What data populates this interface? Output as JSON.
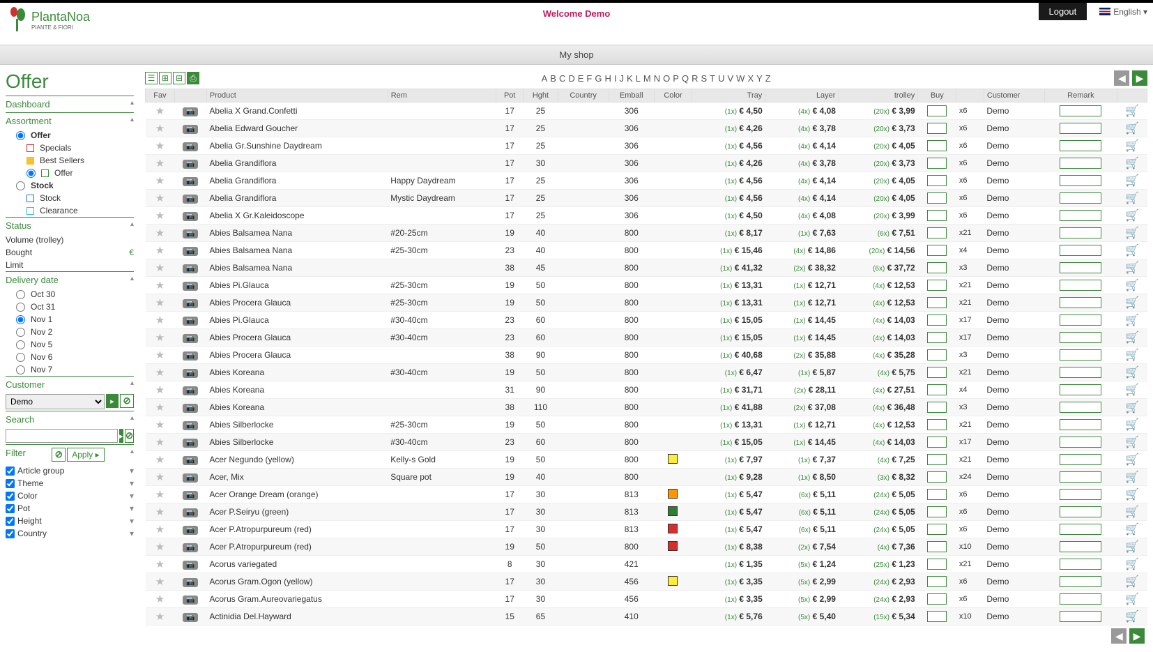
{
  "header": {
    "welcome": "Welcome Demo",
    "logout": "Logout",
    "language": "English ▾",
    "logo_main": "PlantaNoa",
    "logo_sub": "PIANTE & FIORI",
    "shop_banner": "My shop"
  },
  "page_title": "Offer",
  "sidebar": {
    "dashboard": "Dashboard",
    "assortment": "Assortment",
    "offer_group": "Offer",
    "specials": "Specials",
    "bestsellers": "Best Sellers",
    "offer_item": "Offer",
    "stock_group": "Stock",
    "stock_item": "Stock",
    "clearance": "Clearance",
    "status": "Status",
    "volume": "Volume (trolley)",
    "bought": "Bought",
    "bought_val": "€",
    "limit": "Limit",
    "delivery": "Delivery date",
    "dates": [
      "Oct 30",
      "Oct 31",
      "Nov 1",
      "Nov 2",
      "Nov 5",
      "Nov 6",
      "Nov 7"
    ],
    "date_selected": 2,
    "customer": "Customer",
    "customer_val": "Demo",
    "search": "Search",
    "filter": "Filter",
    "apply": "Apply",
    "filters": [
      "Article group",
      "Theme",
      "Color",
      "Pot",
      "Height",
      "Country"
    ]
  },
  "alpha": [
    "A",
    "B",
    "C",
    "D",
    "E",
    "F",
    "G",
    "H",
    "I",
    "J",
    "K",
    "L",
    "M",
    "N",
    "O",
    "P",
    "Q",
    "R",
    "S",
    "T",
    "U",
    "V",
    "W",
    "X",
    "Y",
    "Z"
  ],
  "columns": [
    "Fav",
    "",
    "Product",
    "Rem",
    "Pot",
    "Hght",
    "Country",
    "Emball",
    "Color",
    "Tray",
    "Layer",
    "trolley",
    "Buy",
    "",
    "Customer",
    "Remark",
    ""
  ],
  "rows": [
    {
      "product": "Abelia X Grand.Confetti",
      "rem": "",
      "pot": "17",
      "hght": "25",
      "emb": "306",
      "color": "",
      "tm": "(1x)",
      "tp": "€ 4,50",
      "lm": "(4x)",
      "lp": "€ 4,08",
      "rm2": "(20x)",
      "rp": "€ 3,99",
      "pack": "x6",
      "cust": "Demo"
    },
    {
      "product": "Abelia Edward Goucher",
      "rem": "",
      "pot": "17",
      "hght": "25",
      "emb": "306",
      "color": "",
      "tm": "(1x)",
      "tp": "€ 4,26",
      "lm": "(4x)",
      "lp": "€ 3,78",
      "rm2": "(20x)",
      "rp": "€ 3,73",
      "pack": "x6",
      "cust": "Demo"
    },
    {
      "product": "Abelia Gr.Sunshine Daydream",
      "rem": "",
      "pot": "17",
      "hght": "25",
      "emb": "306",
      "color": "",
      "tm": "(1x)",
      "tp": "€ 4,56",
      "lm": "(4x)",
      "lp": "€ 4,14",
      "rm2": "(20x)",
      "rp": "€ 4,05",
      "pack": "x6",
      "cust": "Demo"
    },
    {
      "product": "Abelia Grandiflora",
      "rem": "",
      "pot": "17",
      "hght": "30",
      "emb": "306",
      "color": "",
      "tm": "(1x)",
      "tp": "€ 4,26",
      "lm": "(4x)",
      "lp": "€ 3,78",
      "rm2": "(20x)",
      "rp": "€ 3,73",
      "pack": "x6",
      "cust": "Demo"
    },
    {
      "product": "Abelia Grandiflora",
      "rem": "Happy Daydream",
      "pot": "17",
      "hght": "25",
      "emb": "306",
      "color": "",
      "tm": "(1x)",
      "tp": "€ 4,56",
      "lm": "(4x)",
      "lp": "€ 4,14",
      "rm2": "(20x)",
      "rp": "€ 4,05",
      "pack": "x6",
      "cust": "Demo"
    },
    {
      "product": "Abelia Grandiflora",
      "rem": "Mystic Daydream",
      "pot": "17",
      "hght": "25",
      "emb": "306",
      "color": "",
      "tm": "(1x)",
      "tp": "€ 4,56",
      "lm": "(4x)",
      "lp": "€ 4,14",
      "rm2": "(20x)",
      "rp": "€ 4,05",
      "pack": "x6",
      "cust": "Demo"
    },
    {
      "product": "Abelia X Gr.Kaleidoscope",
      "rem": "",
      "pot": "17",
      "hght": "25",
      "emb": "306",
      "color": "",
      "tm": "(1x)",
      "tp": "€ 4,50",
      "lm": "(4x)",
      "lp": "€ 4,08",
      "rm2": "(20x)",
      "rp": "€ 3,99",
      "pack": "x6",
      "cust": "Demo"
    },
    {
      "product": "Abies Balsamea Nana",
      "rem": "#20-25cm",
      "pot": "19",
      "hght": "40",
      "emb": "800",
      "color": "",
      "tm": "(1x)",
      "tp": "€ 8,17",
      "lm": "(1x)",
      "lp": "€ 7,63",
      "rm2": "(6x)",
      "rp": "€ 7,51",
      "pack": "x21",
      "cust": "Demo"
    },
    {
      "product": "Abies Balsamea Nana",
      "rem": "#25-30cm",
      "pot": "23",
      "hght": "40",
      "emb": "800",
      "color": "",
      "tm": "(1x)",
      "tp": "€ 15,46",
      "lm": "(4x)",
      "lp": "€ 14,86",
      "rm2": "(20x)",
      "rp": "€ 14,56",
      "pack": "x4",
      "cust": "Demo"
    },
    {
      "product": "Abies Balsamea Nana",
      "rem": "",
      "pot": "38",
      "hght": "45",
      "emb": "800",
      "color": "",
      "tm": "(1x)",
      "tp": "€ 41,32",
      "lm": "(2x)",
      "lp": "€ 38,32",
      "rm2": "(6x)",
      "rp": "€ 37,72",
      "pack": "x3",
      "cust": "Demo"
    },
    {
      "product": "Abies Pi.Glauca",
      "rem": "#25-30cm",
      "pot": "19",
      "hght": "50",
      "emb": "800",
      "color": "",
      "tm": "(1x)",
      "tp": "€ 13,31",
      "lm": "(1x)",
      "lp": "€ 12,71",
      "rm2": "(4x)",
      "rp": "€ 12,53",
      "pack": "x21",
      "cust": "Demo"
    },
    {
      "product": "Abies Procera Glauca",
      "rem": "#25-30cm",
      "pot": "19",
      "hght": "50",
      "emb": "800",
      "color": "",
      "tm": "(1x)",
      "tp": "€ 13,31",
      "lm": "(1x)",
      "lp": "€ 12,71",
      "rm2": "(4x)",
      "rp": "€ 12,53",
      "pack": "x21",
      "cust": "Demo"
    },
    {
      "product": "Abies Pi.Glauca",
      "rem": "#30-40cm",
      "pot": "23",
      "hght": "60",
      "emb": "800",
      "color": "",
      "tm": "(1x)",
      "tp": "€ 15,05",
      "lm": "(1x)",
      "lp": "€ 14,45",
      "rm2": "(4x)",
      "rp": "€ 14,03",
      "pack": "x17",
      "cust": "Demo"
    },
    {
      "product": "Abies Procera Glauca",
      "rem": "#30-40cm",
      "pot": "23",
      "hght": "60",
      "emb": "800",
      "color": "",
      "tm": "(1x)",
      "tp": "€ 15,05",
      "lm": "(1x)",
      "lp": "€ 14,45",
      "rm2": "(4x)",
      "rp": "€ 14,03",
      "pack": "x17",
      "cust": "Demo"
    },
    {
      "product": "Abies Procera Glauca",
      "rem": "",
      "pot": "38",
      "hght": "90",
      "emb": "800",
      "color": "",
      "tm": "(1x)",
      "tp": "€ 40,68",
      "lm": "(2x)",
      "lp": "€ 35,88",
      "rm2": "(4x)",
      "rp": "€ 35,28",
      "pack": "x3",
      "cust": "Demo"
    },
    {
      "product": "Abies Koreana",
      "rem": "#30-40cm",
      "pot": "19",
      "hght": "50",
      "emb": "800",
      "color": "",
      "tm": "(1x)",
      "tp": "€ 6,47",
      "lm": "(1x)",
      "lp": "€ 5,87",
      "rm2": "(4x)",
      "rp": "€ 5,75",
      "pack": "x21",
      "cust": "Demo"
    },
    {
      "product": "Abies Koreana",
      "rem": "",
      "pot": "31",
      "hght": "90",
      "emb": "800",
      "color": "",
      "tm": "(1x)",
      "tp": "€ 31,71",
      "lm": "(2x)",
      "lp": "€ 28,11",
      "rm2": "(4x)",
      "rp": "€ 27,51",
      "pack": "x4",
      "cust": "Demo"
    },
    {
      "product": "Abies Koreana",
      "rem": "",
      "pot": "38",
      "hght": "110",
      "emb": "800",
      "color": "",
      "tm": "(1x)",
      "tp": "€ 41,88",
      "lm": "(2x)",
      "lp": "€ 37,08",
      "rm2": "(4x)",
      "rp": "€ 36,48",
      "pack": "x3",
      "cust": "Demo"
    },
    {
      "product": "Abies Silberlocke",
      "rem": "#25-30cm",
      "pot": "19",
      "hght": "50",
      "emb": "800",
      "color": "",
      "tm": "(1x)",
      "tp": "€ 13,31",
      "lm": "(1x)",
      "lp": "€ 12,71",
      "rm2": "(4x)",
      "rp": "€ 12,53",
      "pack": "x21",
      "cust": "Demo"
    },
    {
      "product": "Abies Silberlocke",
      "rem": "#30-40cm",
      "pot": "23",
      "hght": "60",
      "emb": "800",
      "color": "",
      "tm": "(1x)",
      "tp": "€ 15,05",
      "lm": "(1x)",
      "lp": "€ 14,45",
      "rm2": "(4x)",
      "rp": "€ 14,03",
      "pack": "x17",
      "cust": "Demo"
    },
    {
      "product": "Acer Negundo (yellow)",
      "rem": "Kelly-s Gold",
      "pot": "19",
      "hght": "50",
      "emb": "800",
      "color": "#ffeb3b",
      "tm": "(1x)",
      "tp": "€ 7,97",
      "lm": "(1x)",
      "lp": "€ 7,37",
      "rm2": "(4x)",
      "rp": "€ 7,25",
      "pack": "x21",
      "cust": "Demo"
    },
    {
      "product": "Acer, Mix",
      "rem": "Square pot",
      "pot": "19",
      "hght": "40",
      "emb": "800",
      "color": "",
      "tm": "(1x)",
      "tp": "€ 9,28",
      "lm": "(1x)",
      "lp": "€ 8,50",
      "rm2": "(3x)",
      "rp": "€ 8,32",
      "pack": "x24",
      "cust": "Demo"
    },
    {
      "product": "Acer Orange Dream (orange)",
      "rem": "",
      "pot": "17",
      "hght": "30",
      "emb": "813",
      "color": "#ff9800",
      "tm": "(1x)",
      "tp": "€ 5,47",
      "lm": "(6x)",
      "lp": "€ 5,11",
      "rm2": "(24x)",
      "rp": "€ 5,05",
      "pack": "x6",
      "cust": "Demo"
    },
    {
      "product": "Acer P.Seiryu (green)",
      "rem": "",
      "pot": "17",
      "hght": "30",
      "emb": "813",
      "color": "#2e7d32",
      "tm": "(1x)",
      "tp": "€ 5,47",
      "lm": "(6x)",
      "lp": "€ 5,11",
      "rm2": "(24x)",
      "rp": "€ 5,05",
      "pack": "x6",
      "cust": "Demo"
    },
    {
      "product": "Acer P.Atropurpureum (red)",
      "rem": "",
      "pot": "17",
      "hght": "30",
      "emb": "813",
      "color": "#d32f2f",
      "tm": "(1x)",
      "tp": "€ 5,47",
      "lm": "(6x)",
      "lp": "€ 5,11",
      "rm2": "(24x)",
      "rp": "€ 5,05",
      "pack": "x6",
      "cust": "Demo"
    },
    {
      "product": "Acer P.Atropurpureum (red)",
      "rem": "",
      "pot": "19",
      "hght": "50",
      "emb": "800",
      "color": "#d32f2f",
      "tm": "(1x)",
      "tp": "€ 8,38",
      "lm": "(2x)",
      "lp": "€ 7,54",
      "rm2": "(4x)",
      "rp": "€ 7,36",
      "pack": "x10",
      "cust": "Demo"
    },
    {
      "product": "Acorus variegated",
      "rem": "",
      "pot": "8",
      "hght": "30",
      "emb": "421",
      "color": "",
      "tm": "(1x)",
      "tp": "€ 1,35",
      "lm": "(5x)",
      "lp": "€ 1,24",
      "rm2": "(25x)",
      "rp": "€ 1,23",
      "pack": "x21",
      "cust": "Demo"
    },
    {
      "product": "Acorus Gram.Ogon (yellow)",
      "rem": "",
      "pot": "17",
      "hght": "30",
      "emb": "456",
      "color": "#ffeb3b",
      "tm": "(1x)",
      "tp": "€ 3,35",
      "lm": "(5x)",
      "lp": "€ 2,99",
      "rm2": "(24x)",
      "rp": "€ 2,93",
      "pack": "x6",
      "cust": "Demo"
    },
    {
      "product": "Acorus Gram.Aureovariegatus",
      "rem": "",
      "pot": "17",
      "hght": "30",
      "emb": "456",
      "color": "",
      "tm": "(1x)",
      "tp": "€ 3,35",
      "lm": "(5x)",
      "lp": "€ 2,99",
      "rm2": "(24x)",
      "rp": "€ 2,93",
      "pack": "x6",
      "cust": "Demo"
    },
    {
      "product": "Actinidia Del.Hayward",
      "rem": "",
      "pot": "15",
      "hght": "65",
      "emb": "410",
      "color": "",
      "tm": "(1x)",
      "tp": "€ 5,76",
      "lm": "(5x)",
      "lp": "€ 5,40",
      "rm2": "(15x)",
      "rp": "€ 5,34",
      "pack": "x10",
      "cust": "Demo"
    }
  ]
}
